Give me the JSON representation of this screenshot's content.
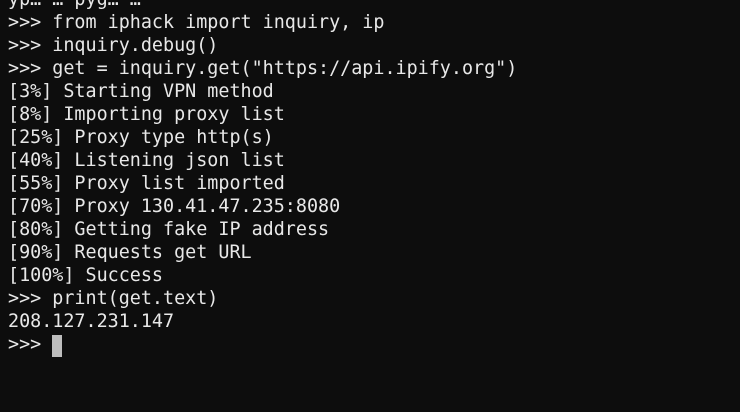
{
  "terminal": {
    "lines": [
      "yp… … pyg… …",
      ">>> from iphack import inquiry, ip",
      ">>> inquiry.debug()",
      ">>> get = inquiry.get(\"https://api.ipify.org\")",
      "[3%] Starting VPN method",
      "[8%] Importing proxy list",
      "[25%] Proxy type http(s)",
      "[40%] Listening json list",
      "[55%] Proxy list imported",
      "[70%] Proxy 130.41.47.235:8080",
      "[80%] Getting fake IP address",
      "[90%] Requests get URL",
      "[100%] Success",
      ">>> print(get.text)",
      "208.127.231.147"
    ],
    "current_prompt": ">>> ",
    "input_value": "",
    "cursor_color": "#bdbdbd",
    "background_color": "#0d0d0d",
    "text_color": "#e8e8e8"
  }
}
